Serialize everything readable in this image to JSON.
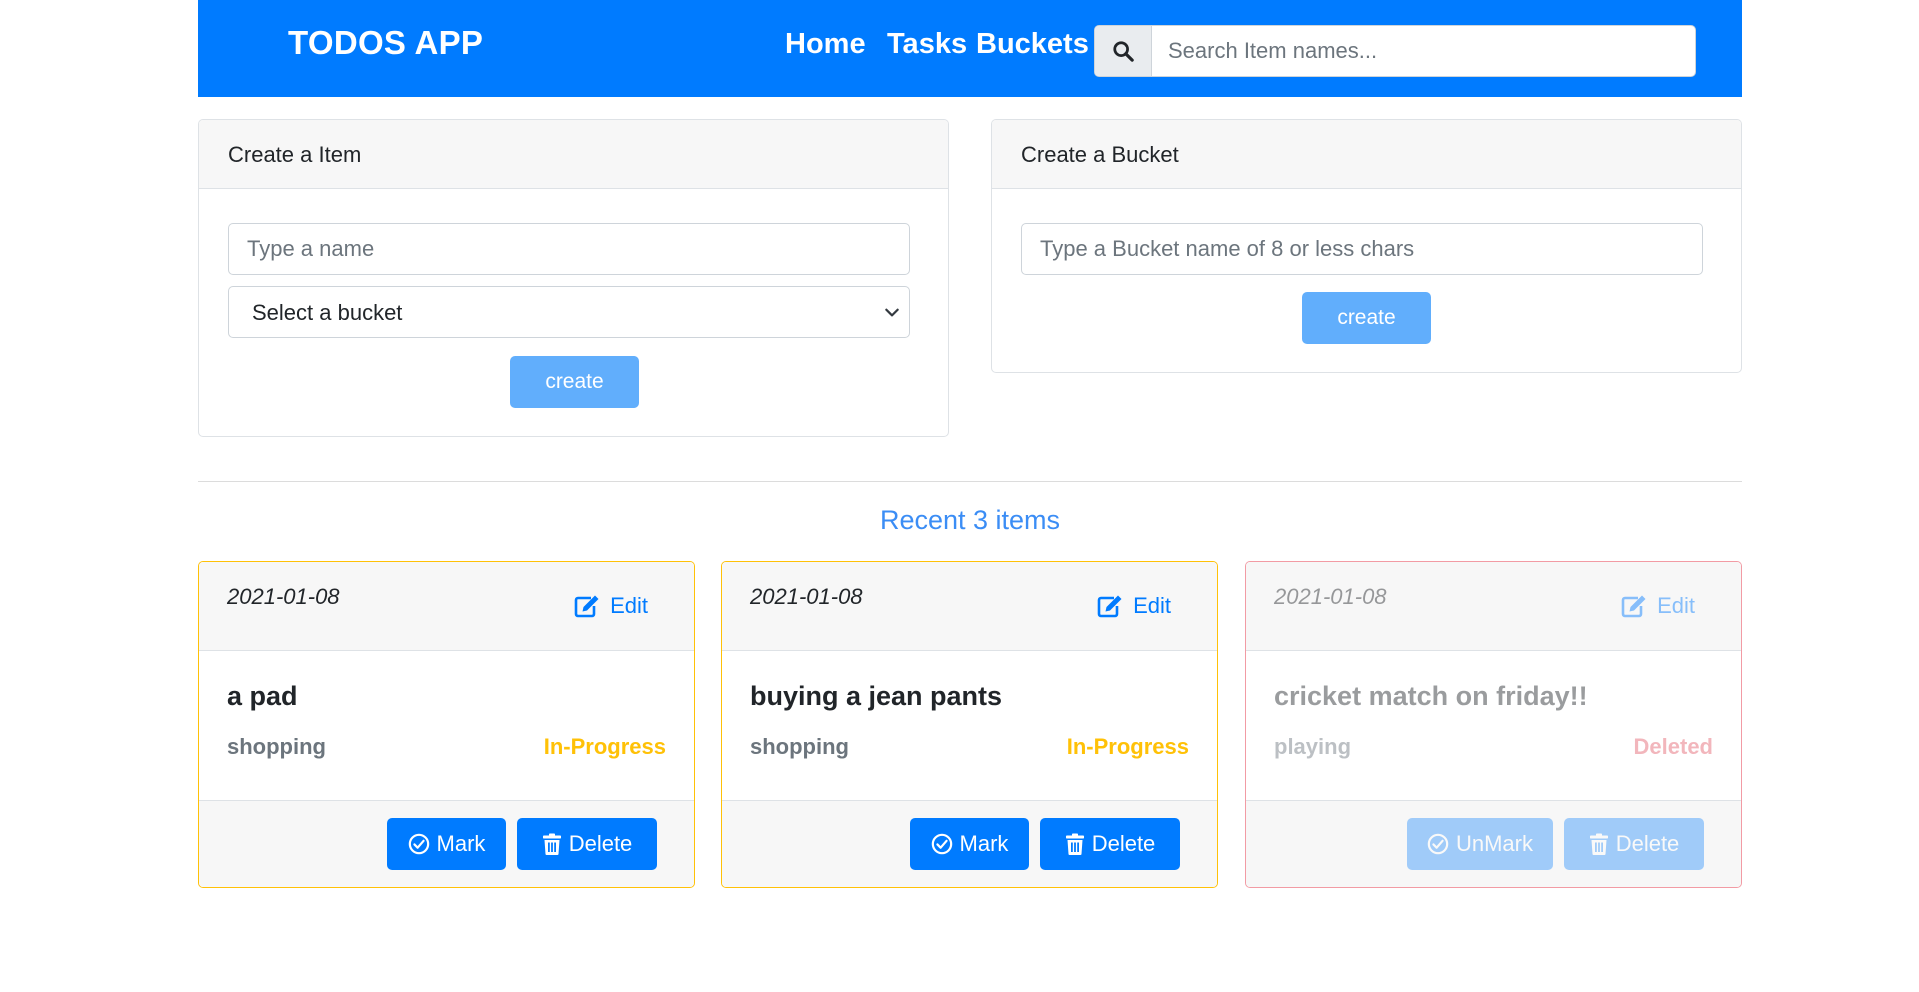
{
  "navbar": {
    "brand": "TODOS APP",
    "links": [
      "Home",
      "Tasks",
      "Buckets"
    ],
    "search_placeholder": "Search Item names...",
    "search_icon": "search-icon",
    "background": "#007bff"
  },
  "create_item": {
    "title": "Create a Item",
    "name_placeholder": "Type a name",
    "bucket_select_value": "Select a bucket",
    "button_label": "create"
  },
  "create_bucket": {
    "title": "Create a Bucket",
    "name_placeholder": "Type a Bucket name of 8 or less chars",
    "button_label": "create"
  },
  "recent": {
    "title": "Recent 3 items",
    "items": [
      {
        "date": "2021-01-08",
        "edit_label": "Edit",
        "name": "a pad",
        "bucket": "shopping",
        "status": "In-Progress",
        "mark_label": "Mark",
        "delete_label": "Delete"
      },
      {
        "date": "2021-01-08",
        "edit_label": "Edit",
        "name": "buying a jean pants",
        "bucket": "shopping",
        "status": "In-Progress",
        "mark_label": "Mark",
        "delete_label": "Delete"
      },
      {
        "date": "2021-01-08",
        "edit_label": "Edit",
        "name": "cricket match on friday!!",
        "bucket": "playing",
        "status": "Deleted",
        "mark_label": "UnMark",
        "delete_label": "Delete"
      }
    ]
  },
  "colors": {
    "primary": "#007bff",
    "in_progress": "#ffc107",
    "deleted": "#dc3545",
    "recent_title": "#3b8df5"
  }
}
